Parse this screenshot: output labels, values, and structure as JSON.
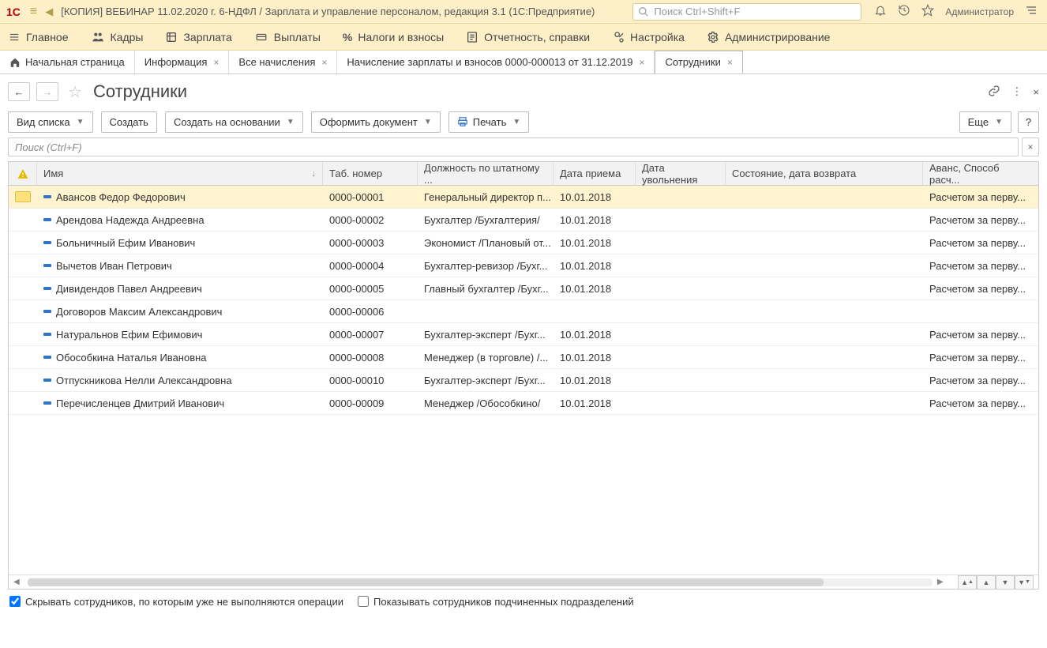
{
  "app": {
    "logo_text": "1C",
    "title": "[КОПИЯ] ВЕБИНАР 11.02.2020 г. 6-НДФЛ / Зарплата и управление персоналом, редакция 3.1  (1С:Предприятие)",
    "search_placeholder": "Поиск Ctrl+Shift+F",
    "user": "Администратор"
  },
  "sections": {
    "items": [
      {
        "label": "Главное"
      },
      {
        "label": "Кадры"
      },
      {
        "label": "Зарплата"
      },
      {
        "label": "Выплаты"
      },
      {
        "label": "Налоги и взносы"
      },
      {
        "label": "Отчетность, справки"
      },
      {
        "label": "Настройка"
      },
      {
        "label": "Администрирование"
      }
    ]
  },
  "doc_tabs": {
    "items": [
      {
        "label": "Начальная страница",
        "closable": false,
        "icon": "home"
      },
      {
        "label": "Информация",
        "closable": true
      },
      {
        "label": "Все начисления",
        "closable": true
      },
      {
        "label": "Начисление зарплаты и взносов 0000-000013 от 31.12.2019",
        "closable": true
      },
      {
        "label": "Сотрудники",
        "closable": true,
        "active": true
      }
    ]
  },
  "page": {
    "title": "Сотрудники"
  },
  "toolbar": {
    "view_mode": "Вид списка",
    "create": "Создать",
    "create_based": "Создать на основании",
    "make_doc": "Оформить документ",
    "print": "Печать",
    "more": "Еще",
    "help": "?"
  },
  "list_search": {
    "placeholder": "Поиск (Ctrl+F)",
    "clear": "×"
  },
  "grid": {
    "columns": [
      "",
      "Имя",
      "Таб. номер",
      "Должность по штатному ...",
      "Дата приема",
      "Дата увольнения",
      "Состояние, дата возврата",
      "Аванс, Способ расч..."
    ],
    "rows": [
      {
        "name": "Авансов Федор Федорович",
        "num": "0000-00001",
        "pos": "Генеральный директор п...",
        "hire": "10.01.2018",
        "fire": "",
        "state": "",
        "adv": "Расчетом за перву...",
        "selected": true
      },
      {
        "name": "Арендова Надежда Андреевна",
        "num": "0000-00002",
        "pos": "Бухгалтер /Бухгалтерия/",
        "hire": "10.01.2018",
        "fire": "",
        "state": "",
        "adv": "Расчетом за перву..."
      },
      {
        "name": "Больничный Ефим Иванович",
        "num": "0000-00003",
        "pos": "Экономист /Плановый от...",
        "hire": "10.01.2018",
        "fire": "",
        "state": "",
        "adv": "Расчетом за перву..."
      },
      {
        "name": "Вычетов Иван Петрович",
        "num": "0000-00004",
        "pos": "Бухгалтер-ревизор /Бухг...",
        "hire": "10.01.2018",
        "fire": "",
        "state": "",
        "adv": "Расчетом за перву..."
      },
      {
        "name": "Дивидендов Павел Андреевич",
        "num": "0000-00005",
        "pos": "Главный бухгалтер /Бухг...",
        "hire": "10.01.2018",
        "fire": "",
        "state": "",
        "adv": "Расчетом за перву..."
      },
      {
        "name": "Договоров Максим Александрович",
        "num": "0000-00006",
        "pos": "",
        "hire": "",
        "fire": "",
        "state": "",
        "adv": ""
      },
      {
        "name": "Натуральнов Ефим Ефимович",
        "num": "0000-00007",
        "pos": "Бухгалтер-эксперт /Бухг...",
        "hire": "10.01.2018",
        "fire": "",
        "state": "",
        "adv": "Расчетом за перву..."
      },
      {
        "name": "Обособкина Наталья Ивановна",
        "num": "0000-00008",
        "pos": "Менеджер (в торговле) /...",
        "hire": "10.01.2018",
        "fire": "",
        "state": "",
        "adv": "Расчетом за перву..."
      },
      {
        "name": "Отпускникова Нелли Александровна",
        "num": "0000-00010",
        "pos": "Бухгалтер-эксперт /Бухг...",
        "hire": "10.01.2018",
        "fire": "",
        "state": "",
        "adv": "Расчетом за перву..."
      },
      {
        "name": "Перечисленцев Дмитрий Иванович",
        "num": "0000-00009",
        "pos": "Менеджер /Обособкино/",
        "hire": "10.01.2018",
        "fire": "",
        "state": "",
        "adv": "Расчетом за перву..."
      }
    ]
  },
  "footer": {
    "hide_employees": "Скрывать сотрудников, по которым уже не выполняются операции",
    "show_subord": "Показывать сотрудников подчиненных подразделений"
  }
}
